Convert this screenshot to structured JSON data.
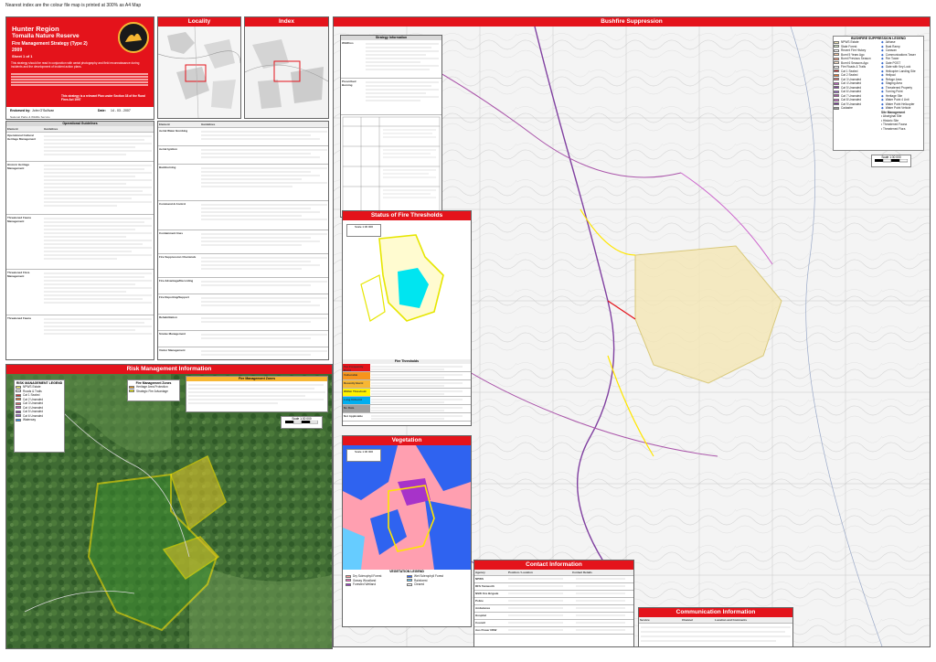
{
  "note": "Nearest index are the colour file map is printed at 300% as A4 Map",
  "title": {
    "region": "Hunter Region",
    "reserve": "Tomalla Nature Reserve",
    "strategy": "Fire Management Strategy (Type 2)",
    "year": "2009",
    "sheet": "Sheet 1 of 1",
    "intro": "This strategy should be read in conjunction with aerial photography and field reconnaissance during incidents and the development of incident action plans.",
    "endorsed_label": "Endorsed by:",
    "endorsed_by": "John O'Sullivan",
    "date_label": "Date:",
    "date": "14 - 03 - 2007",
    "chart_note": "This strategy is a relevant Plan under Section 38 of the Rural Fires Act 1997",
    "nsw_bottom": "National Parks & Wildlife Service"
  },
  "panels": {
    "locality": "Locality",
    "index": "Index",
    "bushfire": "Bushfire Suppression",
    "risk": "Risk Management Information",
    "thresholds": "Status of Fire Thresholds",
    "vegetation": "Vegetation",
    "contact": "Contact Information",
    "communication": "Communication Information"
  },
  "ops_table": {
    "title": "Operational Guidelines",
    "headers": [
      "Element",
      "Guidelines"
    ],
    "rows": [
      "Operational Cultural Heritage Management",
      "Historic Heritage Management",
      "Threatened Fauna Management",
      "Threatened Flora Management",
      "Threatened Fauna"
    ]
  },
  "ops_table_2": {
    "headers": [
      "Element",
      "Guidelines"
    ],
    "rows": [
      "Aerial Water Bombing",
      "Aerial Ignition",
      "Backburning",
      "Command & Control",
      "Containment lines",
      "Fire Suppression Chemicals",
      "Fire Advantage/Recording",
      "Fire Reporting/Support",
      "Rehabilitation",
      "Smoke Management",
      "Visitor Management"
    ]
  },
  "strategy_table": {
    "title": "Strategy Information",
    "rows": [
      "Wildfires",
      "Prescribed Burning"
    ]
  },
  "bushfire_legend": {
    "title": "BUSHFIRE SUPPRESSION LEGEND",
    "items": [
      {
        "label": "NPWS Estate",
        "color": "#f4e6b4"
      },
      {
        "label": "State Forest",
        "color": "#cce4c0"
      },
      {
        "label": "Recent Fire History",
        "color": "#ffffff"
      },
      {
        "label": "Burnt 5 Years Ago",
        "color": "#f6c7a0"
      },
      {
        "label": "Burnt Previous Season",
        "color": "#f39a7c"
      },
      {
        "label": "Burnt 6 Seasons Ago",
        "color": "#fde1c4"
      },
      {
        "label": "Fire Roads & Trails",
        "color": "#ffffff"
      },
      {
        "label": "Cat 1 Sealed",
        "color": "#cc3333"
      },
      {
        "label": "Cat 2 Sealed",
        "color": "#e8772e"
      },
      {
        "label": "Cat 3 Unsealed",
        "color": "#d86a6a"
      },
      {
        "label": "Cat 4 Unsealed",
        "color": "#c060c0"
      },
      {
        "label": "Cat 5 Unsealed",
        "color": "#8040a0"
      },
      {
        "label": "Cat 6 Unsealed",
        "color": "#9966cc"
      },
      {
        "label": "Cat 7 Unsealed",
        "color": "#aa55aa"
      },
      {
        "label": "Cat 8 Unsealed",
        "color": "#cc66cc"
      },
      {
        "label": "Cat 9 Unsealed",
        "color": "#773399"
      },
      {
        "label": "Cadastre",
        "color": "#999999"
      }
    ],
    "right_items": [
      "Airbase",
      "Boat Ramp",
      "Caravan",
      "Communications Tower",
      "Fire Tower",
      "Gate POST",
      "Gate with Key Lock",
      "Helicopter Landing Site",
      "Helipad",
      "Refuge Area",
      "Staging Area",
      "Threatened Property",
      "Turning Point",
      "Heritage Site",
      "Water Point 4 Unit",
      "Water Point Helicopter",
      "Water Point Vehicle"
    ],
    "site_management": "Site Management",
    "site_items": [
      "Aboriginal Site",
      "Historic Site",
      "Threatened Fauna",
      "Threatened Flora"
    ]
  },
  "scale": "Scale 1:30 000",
  "risk_legend": {
    "title": "RISK MANAGEMENT LEGEND",
    "items": [
      {
        "label": "NPWS Estate",
        "color": "#ffff66"
      },
      {
        "label": "Roads & Trails",
        "color": "#ffffff"
      },
      {
        "label": "Cat 1 Sealed",
        "color": "#cc3333"
      },
      {
        "label": "Cat 2 Unsealed",
        "color": "#e8772e"
      },
      {
        "label": "Cat 3 Unsealed",
        "color": "#d86a6a"
      },
      {
        "label": "Cat 4 Unsealed",
        "color": "#c060c0"
      },
      {
        "label": "Cat 5 Unsealed",
        "color": "#8040a0"
      },
      {
        "label": "Cat 6 Unsealed",
        "color": "#9966cc"
      },
      {
        "label": "Waterway",
        "color": "#3399ff"
      }
    ]
  },
  "fire_mgmt_zones": {
    "title": "Fire Management Zones",
    "items": [
      {
        "label": "Heritage Area Protection",
        "color": "#f0a020"
      },
      {
        "label": "Strategic Fire Advantage",
        "color": "#ffff00"
      }
    ]
  },
  "fmz_text_title": "Fire Management Zones",
  "thresholds_table": {
    "title": "Fire Thresholds",
    "rows": [
      {
        "label": "Too Frequently Burnt",
        "color": "#e4131b"
      },
      {
        "label": "Vulnerable",
        "color": "#f7941d"
      },
      {
        "label": "Recently Burnt",
        "color": "#f7b733"
      },
      {
        "label": "Within Threshold",
        "color": "#fff200"
      },
      {
        "label": "Long Unburnt",
        "color": "#00aeef"
      },
      {
        "label": "No Data",
        "color": "#9e9e9e"
      },
      {
        "label": "Not Applicable",
        "color": "#ffffff"
      }
    ]
  },
  "contact": {
    "headers": [
      "Agency",
      "Position / Location",
      "Contact Details"
    ],
    "agencies": [
      "NPWS",
      "RFS Tamworth",
      "NSW Fire Brigade",
      "Police",
      "Ambulance",
      "Hospital",
      "Council",
      "Aus Power NSW"
    ]
  },
  "communication": {
    "headers": [
      "Service",
      "Channel",
      "Location and Comments"
    ]
  },
  "veg_legend": {
    "title": "VEGETATION LEGEND",
    "items": [
      {
        "label": "Dry Sclerophyll Forest",
        "color": "#ff9999"
      },
      {
        "label": "Wet Sclerophyll Forest",
        "color": "#3366ff"
      },
      {
        "label": "Grassy Woodland",
        "color": "#ff66cc"
      },
      {
        "label": "Rainforest",
        "color": "#66ccff"
      },
      {
        "label": "Forested Wetland",
        "color": "#9933cc"
      },
      {
        "label": "Cleared",
        "color": "#ffffff"
      }
    ]
  },
  "colors": {
    "accent": "#e4131b",
    "npws": "#f4e6b4",
    "yellow_line": "#ffe600",
    "cyan": "#00e5f0"
  }
}
